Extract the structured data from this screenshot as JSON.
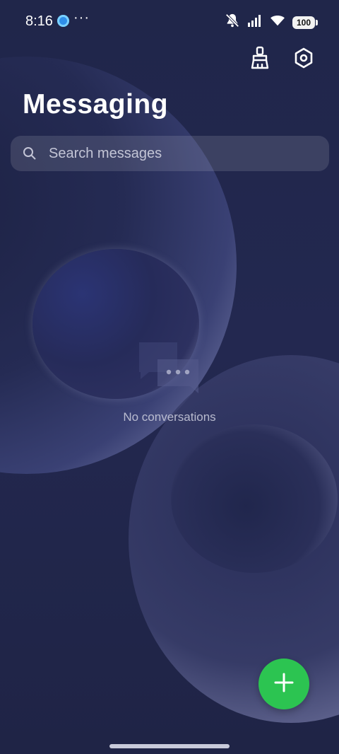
{
  "status_bar": {
    "time": "8:16",
    "app_icon": "notification-app-icon",
    "more_label": "···",
    "battery_level": "100",
    "icons": [
      "mute-icon",
      "signal-icon",
      "wifi-icon",
      "battery-icon"
    ]
  },
  "header": {
    "actions": [
      {
        "name": "clean-icon"
      },
      {
        "name": "settings-icon"
      }
    ],
    "title": "Messaging"
  },
  "search": {
    "placeholder": "Search messages",
    "value": ""
  },
  "empty_state": {
    "icon": "no-conversations-icon",
    "text": "No conversations"
  },
  "fab": {
    "icon": "plus-icon"
  },
  "colors": {
    "background": "#1f2445",
    "accent": "#2cc451",
    "text_primary": "#ffffff",
    "text_secondary": "#c7c9da"
  }
}
